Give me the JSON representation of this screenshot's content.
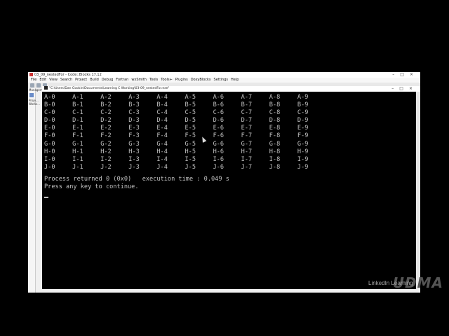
{
  "ide": {
    "title": "03_09_nestedFor - Code::Blocks 17.12",
    "menu": [
      "File",
      "Edit",
      "View",
      "Search",
      "Project",
      "Build",
      "Debug",
      "Fortran",
      "wxSmith",
      "Tools",
      "Tools+",
      "Plugins",
      "DoxyBlocks",
      "Settings",
      "Help"
    ],
    "left_panel": [
      "Managem...",
      "Proje...",
      "Works..."
    ]
  },
  "console": {
    "title": "\"C:\\Users\\Dan Gookin\\Documents\\Learning C Working\\03-09_nestedFor.exe\"",
    "rows": [
      [
        "A-0",
        "A-1",
        "A-2",
        "A-3",
        "A-4",
        "A-5",
        "A-6",
        "A-7",
        "A-8",
        "A-9"
      ],
      [
        "B-0",
        "B-1",
        "B-2",
        "B-3",
        "B-4",
        "B-5",
        "B-6",
        "B-7",
        "B-8",
        "B-9"
      ],
      [
        "C-0",
        "C-1",
        "C-2",
        "C-3",
        "C-4",
        "C-5",
        "C-6",
        "C-7",
        "C-8",
        "C-9"
      ],
      [
        "D-0",
        "D-1",
        "D-2",
        "D-3",
        "D-4",
        "D-5",
        "D-6",
        "D-7",
        "D-8",
        "D-9"
      ],
      [
        "E-0",
        "E-1",
        "E-2",
        "E-3",
        "E-4",
        "E-5",
        "E-6",
        "E-7",
        "E-8",
        "E-9"
      ],
      [
        "F-0",
        "F-1",
        "F-2",
        "F-3",
        "F-4",
        "F-5",
        "F-6",
        "F-7",
        "F-8",
        "F-9"
      ],
      [
        "G-0",
        "G-1",
        "G-2",
        "G-3",
        "G-4",
        "G-5",
        "G-6",
        "G-7",
        "G-8",
        "G-9"
      ],
      [
        "H-0",
        "H-1",
        "H-2",
        "H-3",
        "H-4",
        "H-5",
        "H-6",
        "H-7",
        "H-8",
        "H-9"
      ],
      [
        "I-0",
        "I-1",
        "I-2",
        "I-3",
        "I-4",
        "I-5",
        "I-6",
        "I-7",
        "I-8",
        "I-9"
      ],
      [
        "J-0",
        "J-1",
        "J-2",
        "J-3",
        "J-4",
        "J-5",
        "J-6",
        "J-7",
        "J-8",
        "J-9"
      ]
    ],
    "process_line": "Process returned 0 (0x0)   execution time : 0.049 s",
    "continue_line": "Press any key to continue."
  },
  "branding": {
    "watermark": "UDMA",
    "linkedin": "LinkedIn Learning"
  }
}
